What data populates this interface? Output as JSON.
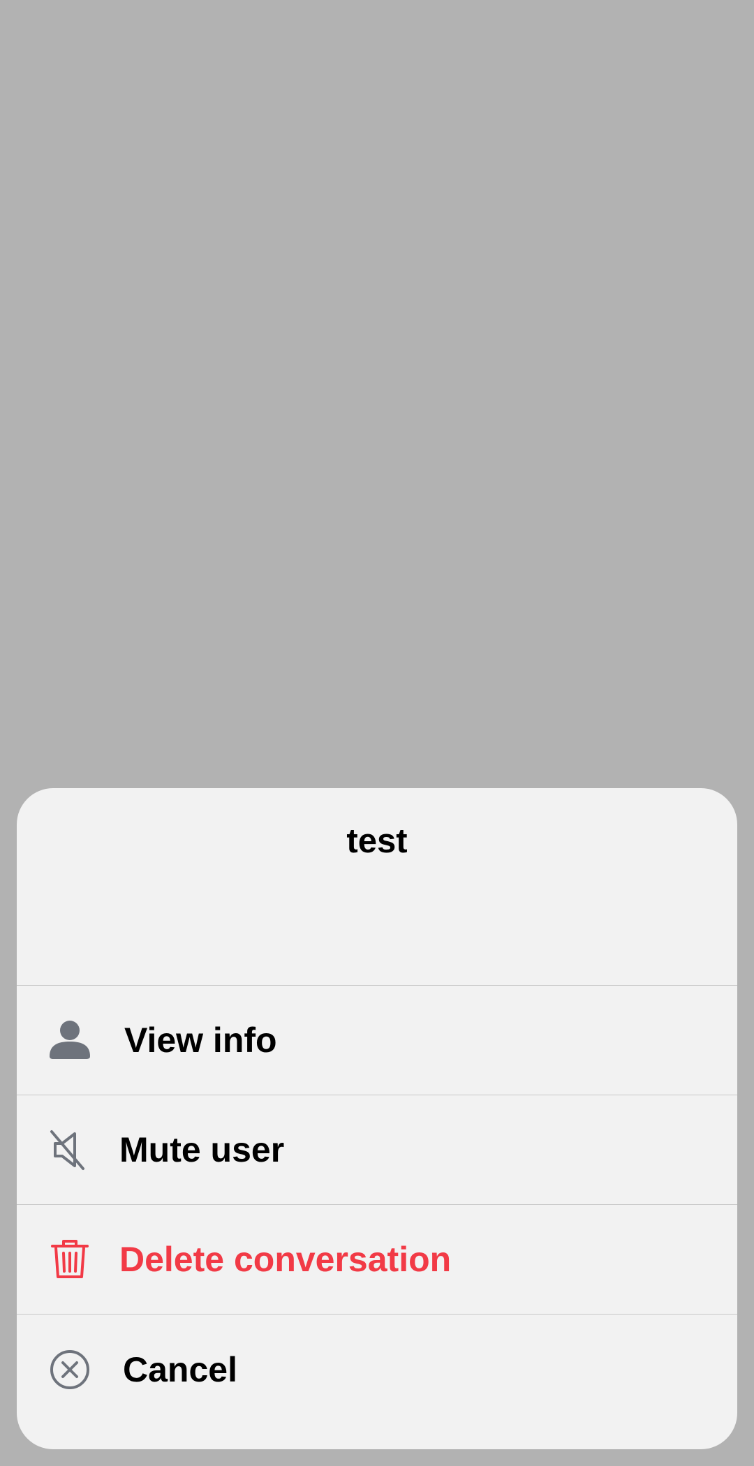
{
  "sheet": {
    "title": "test",
    "actions": [
      {
        "label": "View info",
        "icon": "person-icon",
        "color": "#000000"
      },
      {
        "label": "Mute user",
        "icon": "muted-speaker-icon",
        "color": "#000000"
      },
      {
        "label": "Delete conversation",
        "icon": "trash-icon",
        "color": "#f23a46"
      },
      {
        "label": "Cancel",
        "icon": "close-circle-icon",
        "color": "#000000"
      }
    ]
  },
  "colors": {
    "overlay": "#b2b2b2",
    "sheet_background": "#f2f2f2",
    "divider": "#c8c8c8",
    "icon_gray": "#6e737c",
    "destructive": "#f23a46"
  }
}
